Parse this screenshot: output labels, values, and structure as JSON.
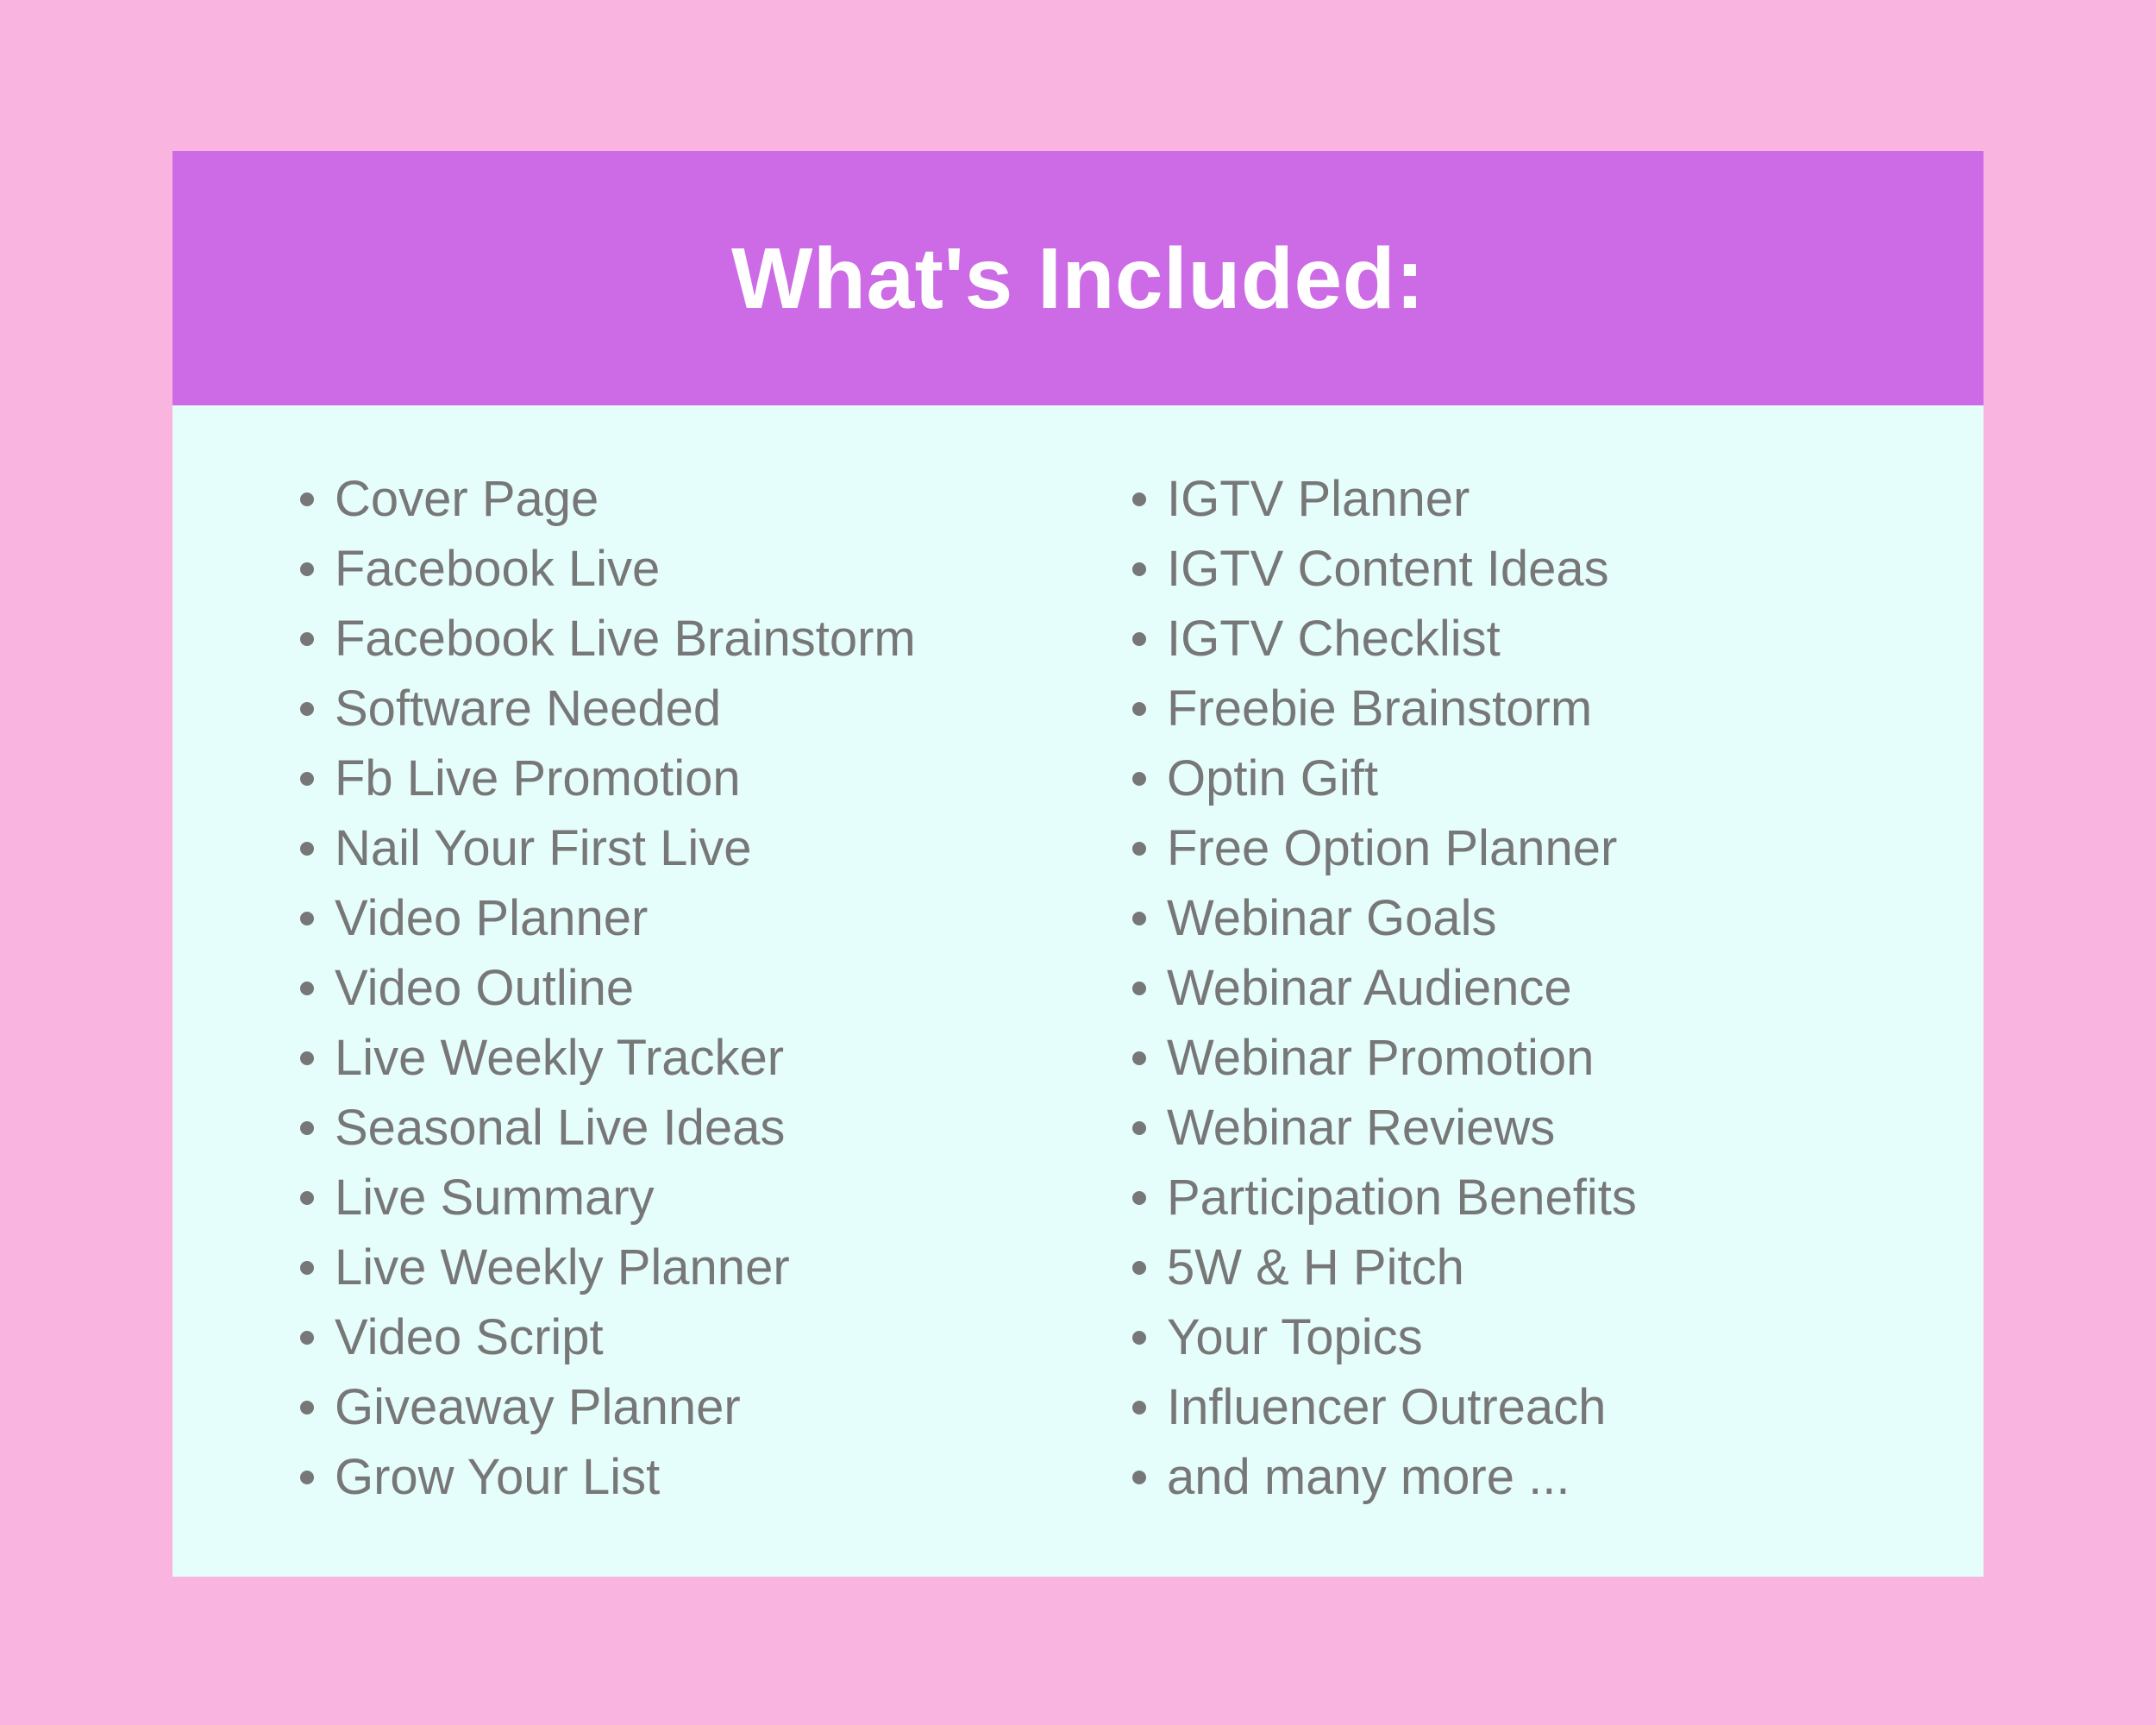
{
  "page": {
    "background_color": "#fab4e0"
  },
  "poster": {
    "header": {
      "title": "What's Included:",
      "background_color": "#cc6be5",
      "text_color": "#ffffff"
    },
    "body": {
      "background_color": "#e5fefb",
      "text_color": "#777777",
      "bullet_color": "#777777",
      "columns": [
        {
          "name": "left-column",
          "items": [
            "Cover Page",
            "Facebook Live",
            "Facebook Live Brainstorm",
            "Software Needed",
            "Fb Live Promotion",
            "Nail Your First Live",
            "Video Planner",
            "Video Outline",
            "Live Weekly Tracker",
            "Seasonal Live Ideas",
            "Live Summary",
            "Live Weekly Planner",
            "Video Script",
            "Giveaway Planner",
            "Grow Your List"
          ]
        },
        {
          "name": "right-column",
          "items": [
            "IGTV Planner",
            "IGTV Content Ideas",
            "IGTV Checklist",
            "Freebie Brainstorm",
            "Optin Gift",
            "Free Option Planner",
            "Webinar Goals",
            "Webinar Audience",
            "Webinar Promotion",
            "Webinar Reviews",
            "Participation Benefits",
            "5W & H Pitch",
            "Your Topics",
            "Influencer Outreach",
            "and many more ..."
          ]
        }
      ]
    }
  }
}
